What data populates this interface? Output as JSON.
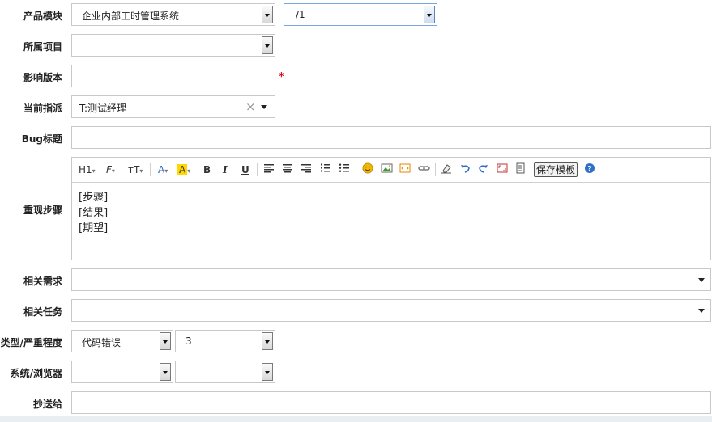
{
  "form": {
    "product_module": {
      "label": "产品模块",
      "product": "企业内部工时管理系统",
      "module": "/1"
    },
    "project": {
      "label": "所属项目",
      "value": ""
    },
    "affected_version": {
      "label": "影响版本",
      "value": "",
      "required_mark": "*"
    },
    "assigned_to": {
      "label": "当前指派",
      "value": "T:测试经理",
      "clear_icon": "×"
    },
    "bug_title": {
      "label": "Bug标题",
      "value": ""
    },
    "steps": {
      "label": "重现步骤",
      "toolbar": {
        "heading": "H1",
        "font": "F",
        "font_size": "тT",
        "font_color": "A",
        "highlight": "A",
        "bold": "B",
        "italic": "I",
        "underline": "U",
        "save_template": "保存模板"
      },
      "lines": [
        "[步骤]",
        "[结果]",
        "[期望]"
      ]
    },
    "related_story": {
      "label": "相关需求",
      "value": ""
    },
    "related_task": {
      "label": "相关任务",
      "value": ""
    },
    "type_severity": {
      "label": "类型/严重程度",
      "type": "代码错误",
      "severity": "3"
    },
    "os_browser": {
      "label": "系统/浏览器",
      "os": "",
      "browser": ""
    },
    "cc": {
      "label": "抄送给",
      "value": ""
    }
  },
  "colors": {
    "required": "#d9000f",
    "focus_border": "#7aa6de",
    "help_icon": "#2f6fc6",
    "emoji": "#f5b800"
  }
}
